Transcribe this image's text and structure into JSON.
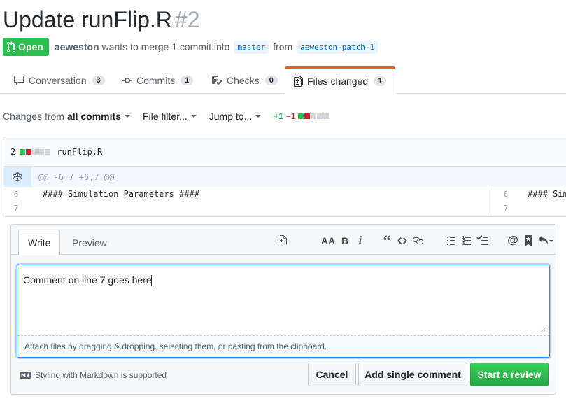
{
  "pr": {
    "title": "Update runFlip.R",
    "number": "#2",
    "state": "Open",
    "author": "aeweston",
    "merge_text": "wants to merge 1 commit into",
    "base_branch": "master",
    "from_text": "from",
    "head_branch": "aeweston-patch-1"
  },
  "tabs": [
    {
      "label": "Conversation",
      "count": "3",
      "icon": "comment-icon"
    },
    {
      "label": "Commits",
      "count": "1",
      "icon": "commit-icon"
    },
    {
      "label": "Checks",
      "count": "0",
      "icon": "checklist-icon"
    },
    {
      "label": "Files changed",
      "count": "1",
      "icon": "file-diff-icon",
      "selected": true
    }
  ],
  "toolbar": {
    "changes_prefix": "Changes from",
    "changes_value": "all commits",
    "file_filter": "File filter...",
    "jump_to": "Jump to...",
    "additions": "+1",
    "deletions": "−1"
  },
  "file": {
    "changes": "2",
    "name": "runFlip.R",
    "hunk": "@@ -6,7 +6,7 @@",
    "lines": [
      {
        "left_num": "6",
        "right_num": "6",
        "text": "#### Simulation Parameters ####",
        "right_text": "#### Sim"
      },
      {
        "left_num": "7",
        "right_num": "7",
        "text": "",
        "right_text": ""
      }
    ]
  },
  "comment": {
    "tab_write": "Write",
    "tab_preview": "Preview",
    "text": "Comment on line 7 goes here",
    "attach_hint": "Attach files by dragging & dropping, selecting them, or pasting from the clipboard.",
    "markdown_note": "Styling with Markdown is supported",
    "cancel": "Cancel",
    "add_single": "Add single comment",
    "start_review": "Start a review"
  },
  "colors": {
    "open_green": "#2cbe4e",
    "primary_green": "#28a745",
    "deletion_red": "#cb2431",
    "link_blue": "#0366d6",
    "tab_accent": "#e36209"
  }
}
